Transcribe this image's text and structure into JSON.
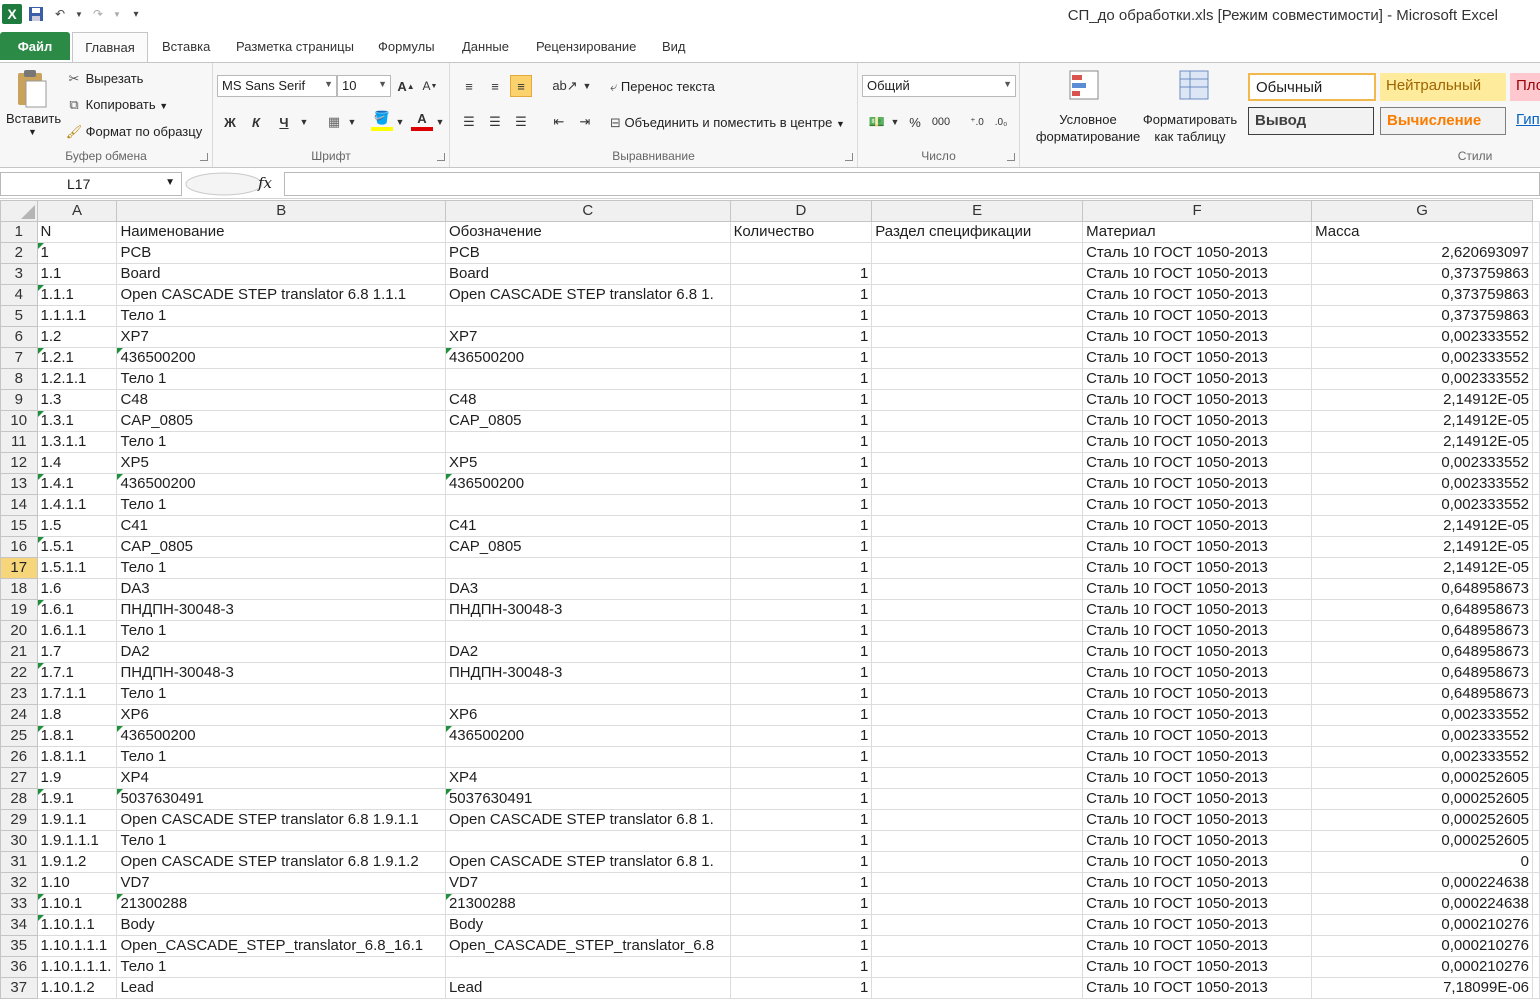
{
  "window": {
    "title": "СП_до обработки.xls  [Режим совместимости]  -  Microsoft Excel"
  },
  "tabs": [
    "Файл",
    "Главная",
    "Вставка",
    "Разметка страницы",
    "Формулы",
    "Данные",
    "Рецензирование",
    "Вид"
  ],
  "ribbon": {
    "clipboard": {
      "paste": "Вставить",
      "cut": "Вырезать",
      "copy": "Копировать",
      "format_painter": "Формат по образцу",
      "label": "Буфер обмена"
    },
    "font": {
      "name": "MS Sans Serif",
      "size": "10",
      "bold": "Ж",
      "italic": "К",
      "underline": "Ч",
      "label": "Шрифт"
    },
    "alignment": {
      "wrap": "Перенос текста",
      "merge": "Объединить и поместить в центре",
      "label": "Выравнивание"
    },
    "number": {
      "format": "Общий",
      "percent": "%",
      "thousands": "000",
      "label": "Число"
    },
    "styles": {
      "conditional": "Условное форматирование",
      "as_table": "Форматировать как таблицу",
      "normal": "Обычный",
      "neutral": "Нейтральный",
      "bad": "Пло",
      "output": "Вывод",
      "calculation": "Вычисление",
      "hyperlink": "Гип",
      "label": "Стили"
    }
  },
  "formula_bar": {
    "cell_ref": "L17",
    "fx": "fx",
    "value": ""
  },
  "sheet": {
    "columns": [
      "A",
      "B",
      "C",
      "D",
      "E",
      "F",
      "G"
    ],
    "selected_row": 17,
    "rows": [
      [
        "N",
        "Наименование",
        "Обозначение",
        "Количество",
        "Раздел спецификации",
        "Материал",
        "Масса"
      ],
      [
        "1",
        "PCB",
        "PCB",
        "",
        "",
        "Сталь 10 ГОСТ 1050-2013",
        "2,620693097"
      ],
      [
        "1.1",
        "Board",
        "Board",
        "1",
        "",
        "Сталь 10 ГОСТ 1050-2013",
        "0,373759863"
      ],
      [
        "1.1.1",
        "Open CASCADE STEP translator 6.8 1.1.1",
        "Open CASCADE STEP translator 6.8 1.",
        "1",
        "",
        "Сталь 10 ГОСТ 1050-2013",
        "0,373759863"
      ],
      [
        "1.1.1.1",
        "Тело 1",
        "",
        "1",
        "",
        "Сталь 10 ГОСТ 1050-2013",
        "0,373759863"
      ],
      [
        "1.2",
        "XP7",
        "XP7",
        "1",
        "",
        "Сталь 10 ГОСТ 1050-2013",
        "0,002333552"
      ],
      [
        "1.2.1",
        "436500200",
        "436500200",
        "1",
        "",
        "Сталь 10 ГОСТ 1050-2013",
        "0,002333552"
      ],
      [
        "1.2.1.1",
        "Тело 1",
        "",
        "1",
        "",
        "Сталь 10 ГОСТ 1050-2013",
        "0,002333552"
      ],
      [
        "1.3",
        "C48",
        "C48",
        "1",
        "",
        "Сталь 10 ГОСТ 1050-2013",
        "2,14912E-05"
      ],
      [
        "1.3.1",
        "CAP_0805",
        "CAP_0805",
        "1",
        "",
        "Сталь 10 ГОСТ 1050-2013",
        "2,14912E-05"
      ],
      [
        "1.3.1.1",
        "Тело 1",
        "",
        "1",
        "",
        "Сталь 10 ГОСТ 1050-2013",
        "2,14912E-05"
      ],
      [
        "1.4",
        "XP5",
        "XP5",
        "1",
        "",
        "Сталь 10 ГОСТ 1050-2013",
        "0,002333552"
      ],
      [
        "1.4.1",
        "436500200",
        "436500200",
        "1",
        "",
        "Сталь 10 ГОСТ 1050-2013",
        "0,002333552"
      ],
      [
        "1.4.1.1",
        "Тело 1",
        "",
        "1",
        "",
        "Сталь 10 ГОСТ 1050-2013",
        "0,002333552"
      ],
      [
        "1.5",
        "C41",
        "C41",
        "1",
        "",
        "Сталь 10 ГОСТ 1050-2013",
        "2,14912E-05"
      ],
      [
        "1.5.1",
        "CAP_0805",
        "CAP_0805",
        "1",
        "",
        "Сталь 10 ГОСТ 1050-2013",
        "2,14912E-05"
      ],
      [
        "1.5.1.1",
        "Тело 1",
        "",
        "1",
        "",
        "Сталь 10 ГОСТ 1050-2013",
        "2,14912E-05"
      ],
      [
        "1.6",
        "DA3",
        "DA3",
        "1",
        "",
        "Сталь 10 ГОСТ 1050-2013",
        "0,648958673"
      ],
      [
        "1.6.1",
        "ПНДПН-30048-3",
        "ПНДПН-30048-3",
        "1",
        "",
        "Сталь 10 ГОСТ 1050-2013",
        "0,648958673"
      ],
      [
        "1.6.1.1",
        "Тело 1",
        "",
        "1",
        "",
        "Сталь 10 ГОСТ 1050-2013",
        "0,648958673"
      ],
      [
        "1.7",
        "DA2",
        "DA2",
        "1",
        "",
        "Сталь 10 ГОСТ 1050-2013",
        "0,648958673"
      ],
      [
        "1.7.1",
        "ПНДПН-30048-3",
        "ПНДПН-30048-3",
        "1",
        "",
        "Сталь 10 ГОСТ 1050-2013",
        "0,648958673"
      ],
      [
        "1.7.1.1",
        "Тело 1",
        "",
        "1",
        "",
        "Сталь 10 ГОСТ 1050-2013",
        "0,648958673"
      ],
      [
        "1.8",
        "XP6",
        "XP6",
        "1",
        "",
        "Сталь 10 ГОСТ 1050-2013",
        "0,002333552"
      ],
      [
        "1.8.1",
        "436500200",
        "436500200",
        "1",
        "",
        "Сталь 10 ГОСТ 1050-2013",
        "0,002333552"
      ],
      [
        "1.8.1.1",
        "Тело 1",
        "",
        "1",
        "",
        "Сталь 10 ГОСТ 1050-2013",
        "0,002333552"
      ],
      [
        "1.9",
        "XP4",
        "XP4",
        "1",
        "",
        "Сталь 10 ГОСТ 1050-2013",
        "0,000252605"
      ],
      [
        "1.9.1",
        "5037630491",
        "5037630491",
        "1",
        "",
        "Сталь 10 ГОСТ 1050-2013",
        "0,000252605"
      ],
      [
        "1.9.1.1",
        "Open CASCADE STEP translator 6.8 1.9.1.1",
        "Open CASCADE STEP translator 6.8 1.",
        "1",
        "",
        "Сталь 10 ГОСТ 1050-2013",
        "0,000252605"
      ],
      [
        "1.9.1.1.1",
        "Тело 1",
        "",
        "1",
        "",
        "Сталь 10 ГОСТ 1050-2013",
        "0,000252605"
      ],
      [
        "1.9.1.2",
        "Open CASCADE STEP translator 6.8 1.9.1.2",
        "Open CASCADE STEP translator 6.8 1.",
        "1",
        "",
        "Сталь 10 ГОСТ 1050-2013",
        "0"
      ],
      [
        "1.10",
        "VD7",
        "VD7",
        "1",
        "",
        "Сталь 10 ГОСТ 1050-2013",
        "0,000224638"
      ],
      [
        "1.10.1",
        "21300288",
        "21300288",
        "1",
        "",
        "Сталь 10 ГОСТ 1050-2013",
        "0,000224638"
      ],
      [
        "1.10.1.1",
        "Body",
        "Body",
        "1",
        "",
        "Сталь 10 ГОСТ 1050-2013",
        "0,000210276"
      ],
      [
        "1.10.1.1.1",
        "Open_CASCADE_STEP_translator_6.8_16.1",
        "Open_CASCADE_STEP_translator_6.8",
        "1",
        "",
        "Сталь 10 ГОСТ 1050-2013",
        "0,000210276"
      ],
      [
        "1.10.1.1.1.",
        "Тело 1",
        "",
        "1",
        "",
        "Сталь 10 ГОСТ 1050-2013",
        "0,000210276"
      ],
      [
        "1.10.1.2",
        "Lead",
        "Lead",
        "1",
        "",
        "Сталь 10 ГОСТ 1050-2013",
        "7,18099E-06"
      ]
    ]
  },
  "colors": {
    "file_tab": "#2c8a47",
    "selected_row_header": "#f7d57a",
    "text_marker": "#1e8f3a",
    "neutral_bg": "#ffeb9c",
    "bad_bg": "#ffc7ce"
  }
}
